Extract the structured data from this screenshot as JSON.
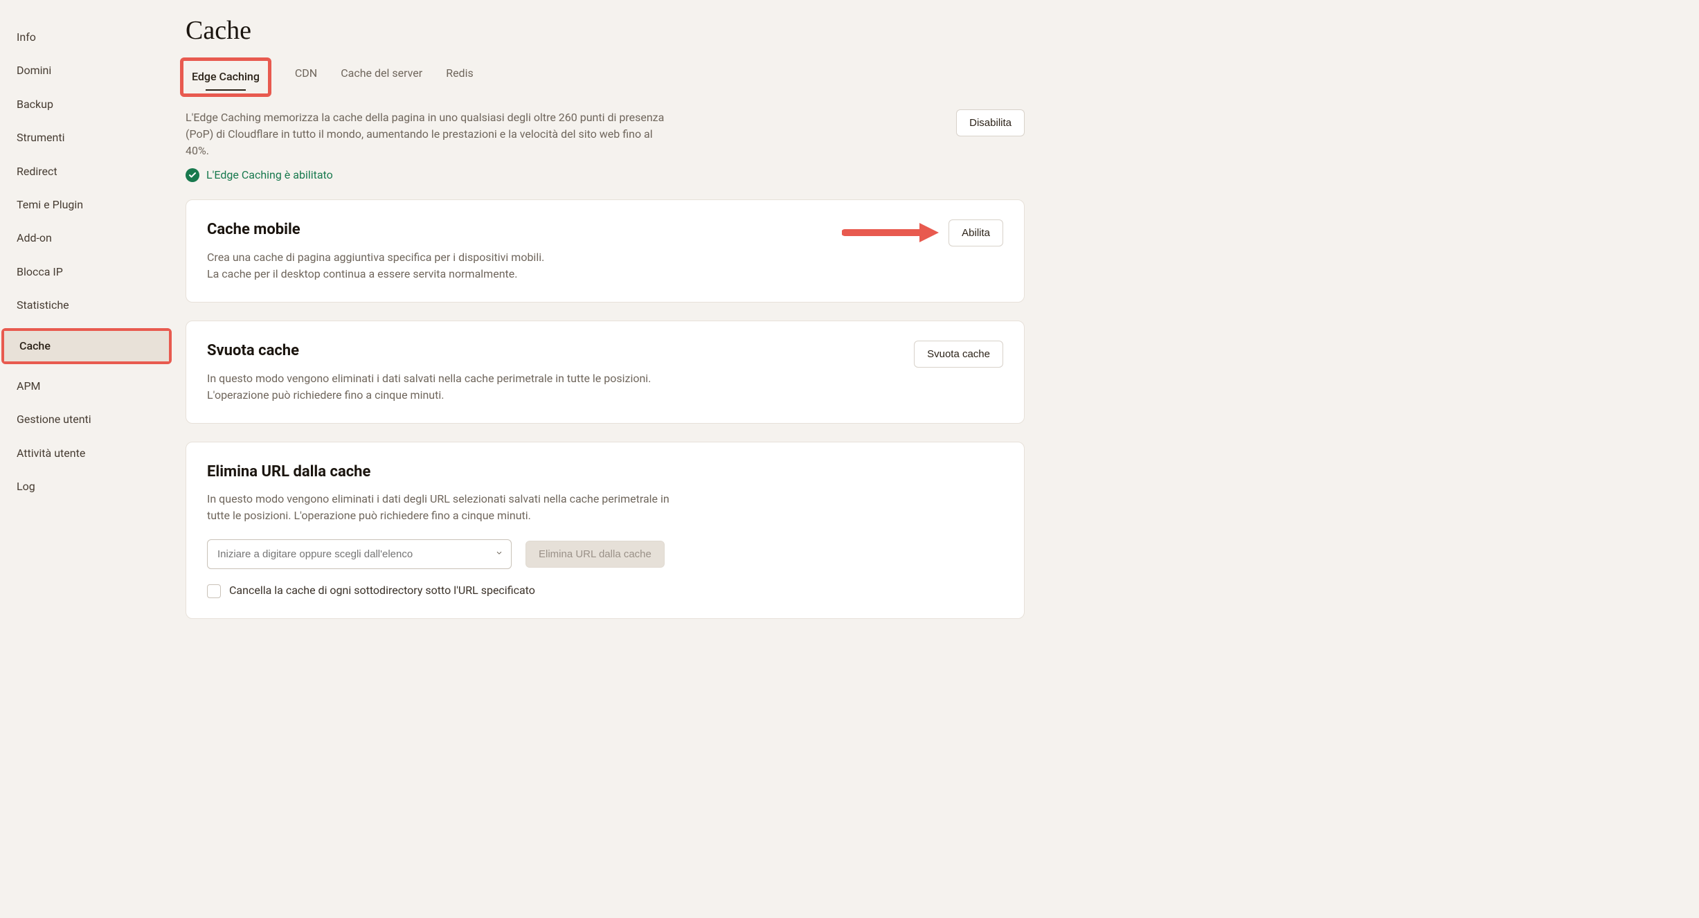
{
  "sidebar": {
    "items": [
      {
        "label": "Info"
      },
      {
        "label": "Domini"
      },
      {
        "label": "Backup"
      },
      {
        "label": "Strumenti"
      },
      {
        "label": "Redirect"
      },
      {
        "label": "Temi e Plugin"
      },
      {
        "label": "Add-on"
      },
      {
        "label": "Blocca IP"
      },
      {
        "label": "Statistiche"
      },
      {
        "label": "Cache"
      },
      {
        "label": "APM"
      },
      {
        "label": "Gestione utenti"
      },
      {
        "label": "Attività utente"
      },
      {
        "label": "Log"
      }
    ],
    "active_index": 9
  },
  "page": {
    "title": "Cache"
  },
  "tabs": {
    "items": [
      {
        "label": "Edge Caching"
      },
      {
        "label": "CDN"
      },
      {
        "label": "Cache del server"
      },
      {
        "label": "Redis"
      }
    ],
    "active_index": 0
  },
  "edge": {
    "description": "L'Edge Caching memorizza la cache della pagina in uno qualsiasi degli oltre 260 punti di presenza (PoP) di Cloudflare in tutto il mondo, aumentando le prestazioni e la velocità del sito web fino al 40%.",
    "disable_label": "Disabilita",
    "status_text": "L'Edge Caching è abilitato"
  },
  "mobile": {
    "title": "Cache mobile",
    "desc_line1": "Crea una cache di pagina aggiuntiva specifica per i dispositivi mobili.",
    "desc_line2": "La cache per il desktop continua a essere servita normalmente.",
    "enable_label": "Abilita"
  },
  "clear": {
    "title": "Svuota cache",
    "desc": "In questo modo vengono eliminati i dati salvati nella cache perimetrale in tutte le posizioni. L'operazione può richiedere fino a cinque minuti.",
    "button_label": "Svuota cache"
  },
  "urlpurge": {
    "title": "Elimina URL dalla cache",
    "desc": "In questo modo vengono eliminati i dati degli URL selezionati salvati nella cache perimetrale in tutte le posizioni. L'operazione può richiedere fino a cinque minuti.",
    "placeholder": "Iniziare a digitare oppure scegli dall'elenco",
    "button_label": "Elimina URL dalla cache",
    "checkbox_label": "Cancella la cache di ogni sottodirectory sotto l'URL specificato"
  },
  "annotations": {
    "highlight_color": "#e85a4f"
  }
}
